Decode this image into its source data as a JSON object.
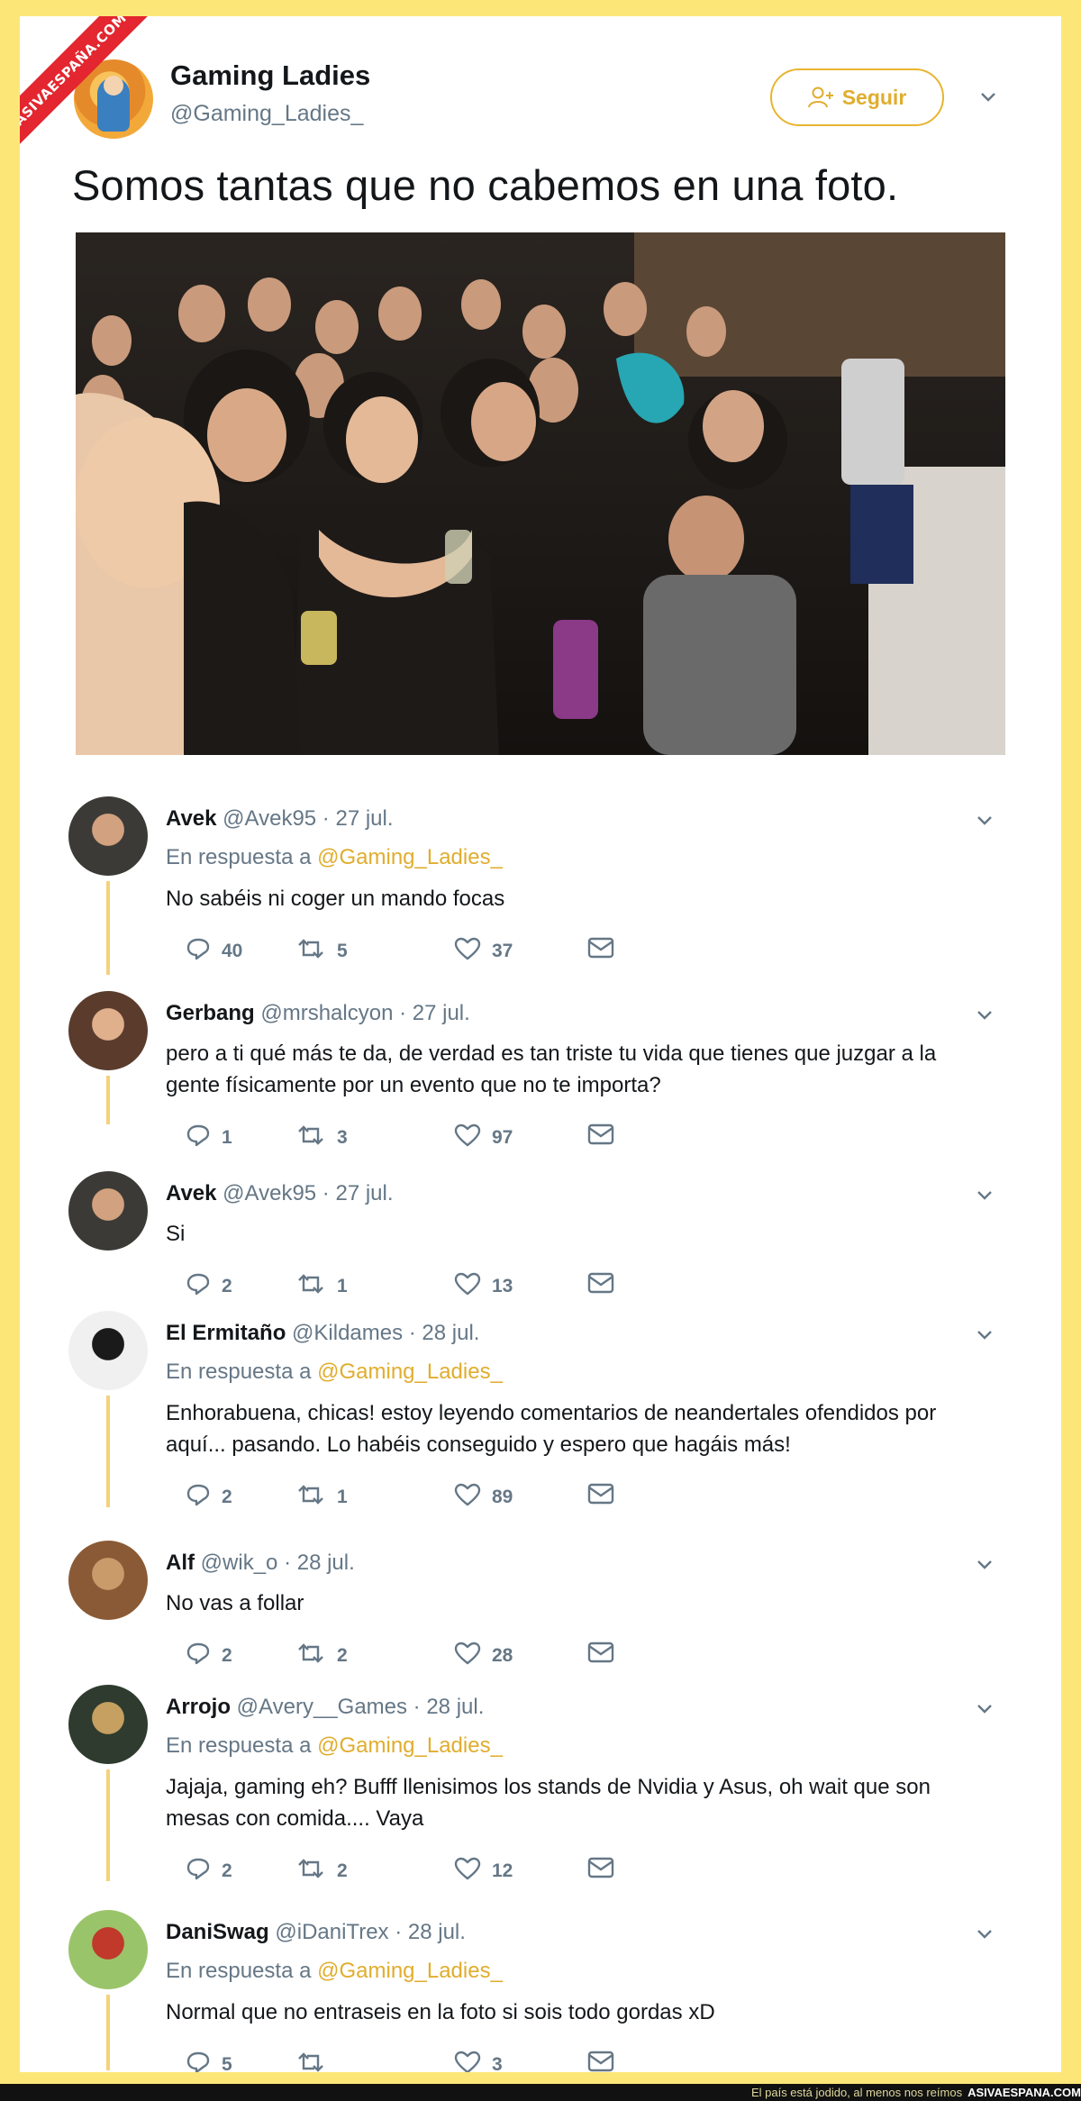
{
  "watermark": "ASIVAESPAÑA.COM",
  "tweet": {
    "name": "Gaming Ladies",
    "handle": "@Gaming_Ladies_",
    "follow_label": "Seguir",
    "text": "Somos tantas que no cabemos en una foto."
  },
  "replies": [
    {
      "name": "Avek",
      "meta": "@Avek95 · 27 jul.",
      "in_reply": "En respuesta a",
      "in_reply_to": "@Gaming_Ladies_",
      "lines": [
        "No sabéis ni coger un mando focas"
      ],
      "replies": "40",
      "retweets": "5",
      "likes": "37"
    },
    {
      "name": "Gerbang",
      "meta": "@mrshalcyon · 27 jul.",
      "in_reply": "",
      "in_reply_to": "",
      "lines": [
        "pero a ti qué más te da, de verdad es tan triste tu vida que tienes que juzgar a la",
        "gente físicamente por un evento que no te importa?"
      ],
      "replies": "1",
      "retweets": "3",
      "likes": "97"
    },
    {
      "name": "Avek",
      "meta": "@Avek95 · 27 jul.",
      "in_reply": "",
      "in_reply_to": "",
      "lines": [
        "Si"
      ],
      "replies": "2",
      "retweets": "1",
      "likes": "13"
    },
    {
      "name": "El Ermitaño",
      "meta": "@Kildames · 28 jul.",
      "in_reply": "En respuesta a",
      "in_reply_to": "@Gaming_Ladies_",
      "lines": [
        "Enhorabuena, chicas! estoy leyendo comentarios de neandertales ofendidos por",
        "aquí... pasando. Lo habéis conseguido y espero que hagáis más!"
      ],
      "replies": "2",
      "retweets": "1",
      "likes": "89"
    },
    {
      "name": "Alf",
      "meta": "@wik_o · 28 jul.",
      "in_reply": "",
      "in_reply_to": "",
      "lines": [
        "No vas a follar"
      ],
      "replies": "2",
      "retweets": "2",
      "likes": "28"
    },
    {
      "name": "Arrojo",
      "meta": "@Avery__Games · 28 jul.",
      "in_reply": "En respuesta a",
      "in_reply_to": "@Gaming_Ladies_",
      "lines": [
        "Jajaja, gaming eh? Bufff llenisimos los stands de Nvidia y Asus, oh wait que son",
        "mesas con comida.... Vaya"
      ],
      "replies": "2",
      "retweets": "2",
      "likes": "12"
    },
    {
      "name": "DaniSwag",
      "meta": "@iDaniTrex · 28 jul.",
      "in_reply": "En respuesta a",
      "in_reply_to": "@Gaming_Ladies_",
      "lines": [
        "Normal que no entraseis en la foto si sois todo gordas xD"
      ],
      "replies": "5",
      "retweets": "",
      "likes": "3"
    }
  ],
  "footer": {
    "tagline": "El país está jodido, al menos nos reímos",
    "site": "ASIVAESPANA.COM"
  },
  "colors": {
    "accent": "#e0ad2e",
    "frame": "#fce678",
    "muted": "#657786",
    "text": "#14171a"
  }
}
